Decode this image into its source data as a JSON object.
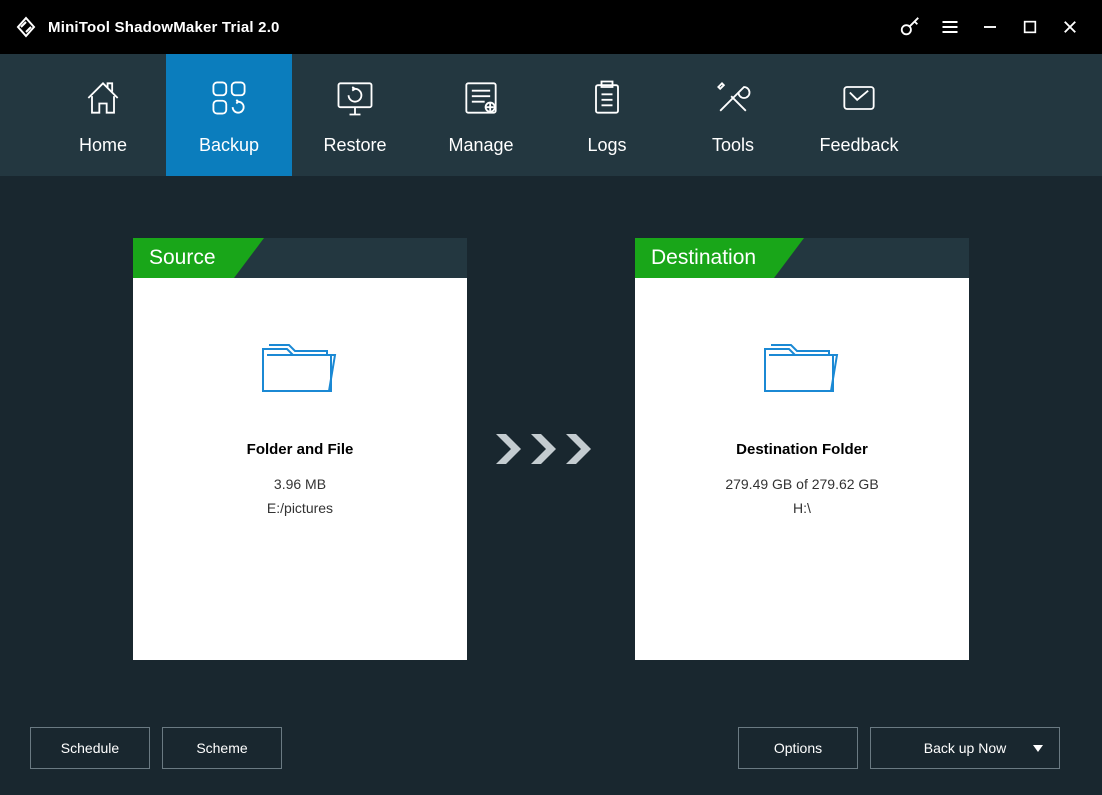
{
  "titlebar": {
    "app_title": "MiniTool ShadowMaker Trial 2.0"
  },
  "nav": {
    "items": [
      {
        "label": "Home"
      },
      {
        "label": "Backup"
      },
      {
        "label": "Restore"
      },
      {
        "label": "Manage"
      },
      {
        "label": "Logs"
      },
      {
        "label": "Tools"
      },
      {
        "label": "Feedback"
      }
    ]
  },
  "source": {
    "tag": "Source",
    "heading": "Folder and File",
    "size": "3.96 MB",
    "path": "E:/pictures"
  },
  "destination": {
    "tag": "Destination",
    "heading": "Destination Folder",
    "size": "279.49 GB of 279.62 GB",
    "path": "H:\\"
  },
  "buttons": {
    "schedule": "Schedule",
    "scheme": "Scheme",
    "options": "Options",
    "backup_now": "Back up Now"
  }
}
